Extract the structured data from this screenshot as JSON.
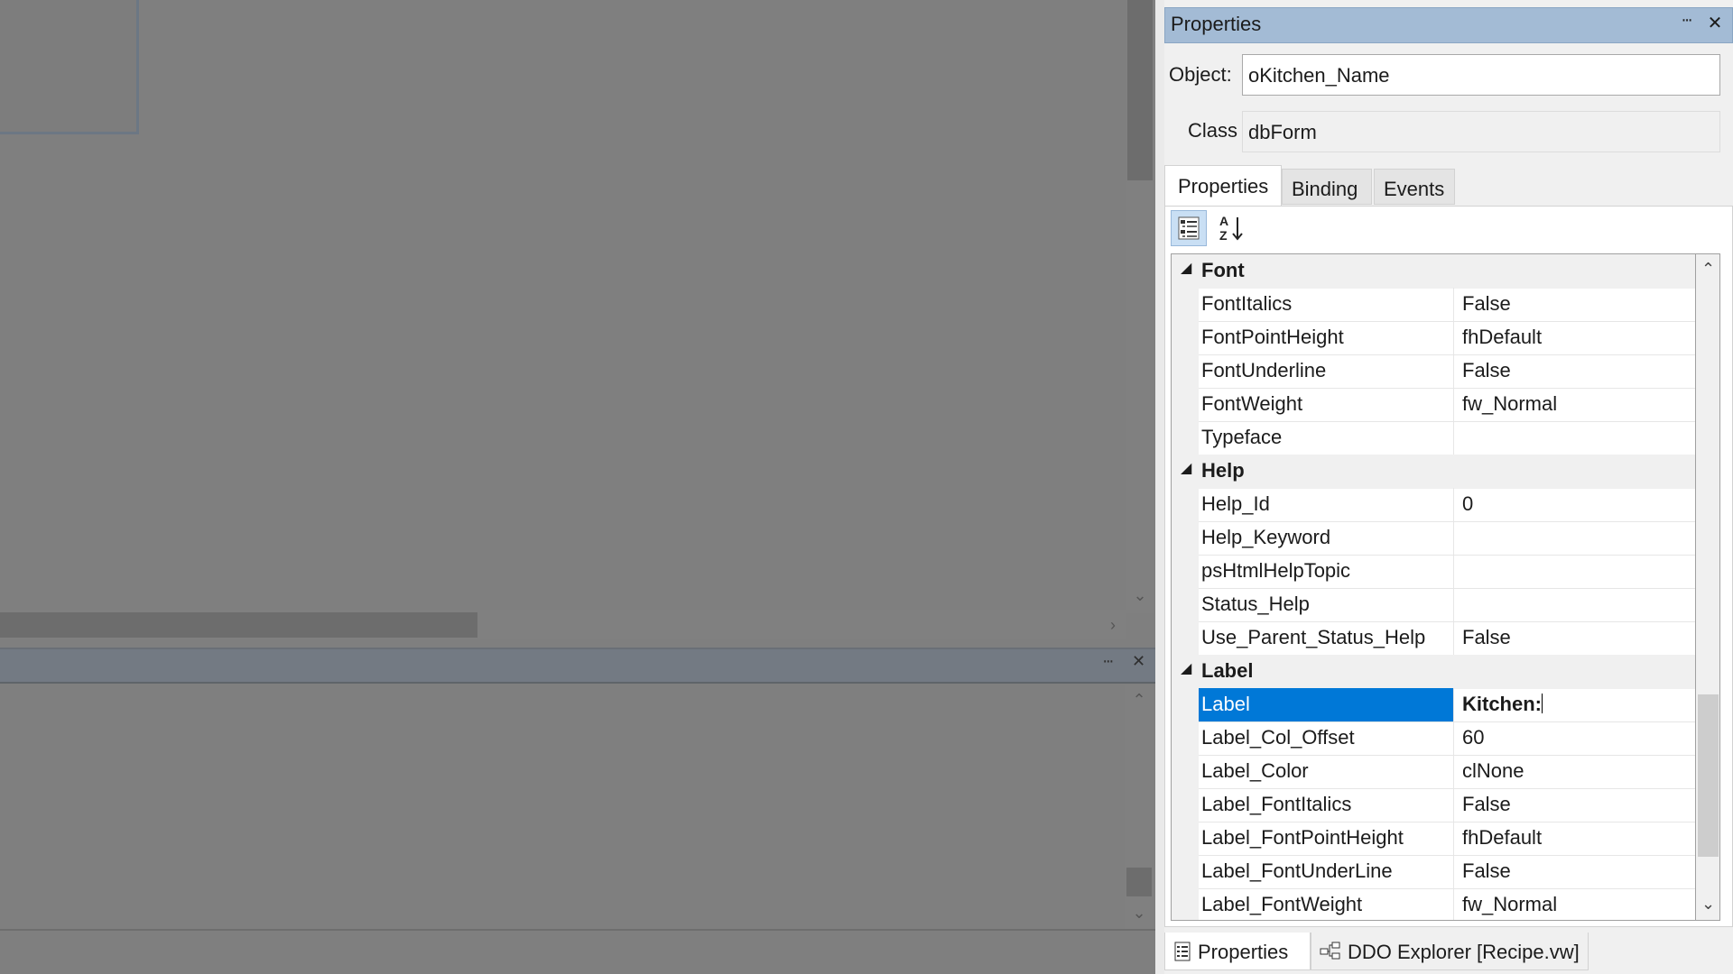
{
  "designer": {
    "bottom_pane": {
      "pin_icon": "pin-icon",
      "close_icon": "close-icon"
    }
  },
  "properties_panel": {
    "title": "Properties",
    "pin_glyph": "ⵈ",
    "close_glyph": "✕",
    "object_label": "Object:",
    "object_value": "oKitchen_Name",
    "class_label": "Class",
    "class_value": "dbForm",
    "tabs": [
      "Properties",
      "Binding",
      "Events"
    ],
    "active_tab": "Properties",
    "categories": [
      {
        "name": "Font",
        "rows": [
          {
            "name": "FontItalics",
            "value": "False"
          },
          {
            "name": "FontPointHeight",
            "value": "fhDefault"
          },
          {
            "name": "FontUnderline",
            "value": "False"
          },
          {
            "name": "FontWeight",
            "value": "fw_Normal"
          },
          {
            "name": "Typeface",
            "value": ""
          }
        ]
      },
      {
        "name": "Help",
        "rows": [
          {
            "name": "Help_Id",
            "value": "0"
          },
          {
            "name": "Help_Keyword",
            "value": ""
          },
          {
            "name": "psHtmlHelpTopic",
            "value": ""
          },
          {
            "name": "Status_Help",
            "value": ""
          },
          {
            "name": "Use_Parent_Status_Help",
            "value": "False"
          }
        ]
      },
      {
        "name": "Label",
        "rows": [
          {
            "name": "Label",
            "value": "Kitchen:",
            "selected": true
          },
          {
            "name": "Label_Col_Offset",
            "value": "60"
          },
          {
            "name": "Label_Color",
            "value": "clNone"
          },
          {
            "name": "Label_FontItalics",
            "value": "False"
          },
          {
            "name": "Label_FontPointHeight",
            "value": "fhDefault"
          },
          {
            "name": "Label_FontUnderLine",
            "value": "False"
          },
          {
            "name": "Label_FontWeight",
            "value": "fw_Normal"
          }
        ]
      }
    ],
    "bottom_tabs": [
      "Properties",
      "DDO Explorer [Recipe.vw]"
    ],
    "colors": {
      "title_bar": "#a3bbd5",
      "selection": "#0078d7",
      "designer_background": "#7f7f7f"
    }
  }
}
